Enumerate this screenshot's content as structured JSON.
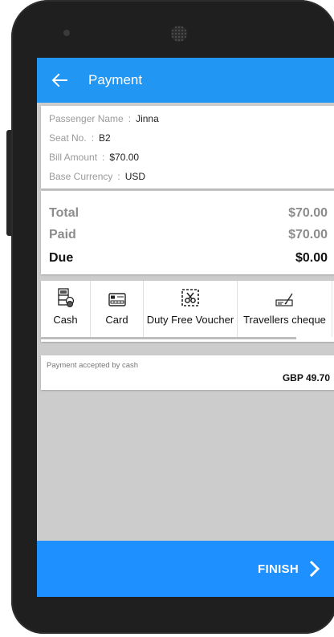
{
  "appbar": {
    "title": "Payment"
  },
  "passenger": {
    "name_label": "Passenger Name",
    "name_value": "Jinna",
    "seat_label": "Seat No.",
    "seat_value": "B2",
    "bill_label": "Bill Amount",
    "bill_value": "$70.00",
    "currency_label": "Base Currency",
    "currency_value": "USD",
    "separator": ":"
  },
  "totals": {
    "total_label": "Total",
    "total_value": "$70.00",
    "paid_label": "Paid",
    "paid_value": "$70.00",
    "due_label": "Due",
    "due_value": "$0.00"
  },
  "payment_methods": [
    {
      "label": "Cash",
      "icon": "cash-icon"
    },
    {
      "label": "Card",
      "icon": "card-icon"
    },
    {
      "label": "Duty Free Voucher",
      "icon": "voucher-scissors-icon"
    },
    {
      "label": "Travellers cheque",
      "icon": "cheque-icon"
    }
  ],
  "result": {
    "message": "Payment accepted by cash",
    "amount": "GBP 49.70"
  },
  "footer": {
    "finish_label": "FINISH"
  },
  "colors": {
    "primary": "#2196f3",
    "footer": "#1e90ff",
    "screen_bg": "#cccccc"
  }
}
